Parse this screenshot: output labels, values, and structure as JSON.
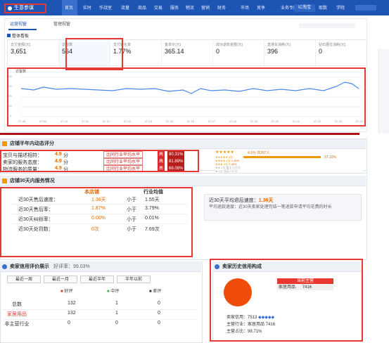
{
  "topbar": {
    "brand": "生意参谋",
    "nav": [
      "首页",
      "实时",
      "作战室",
      "流量",
      "商品",
      "交易",
      "服务",
      "物流",
      "营销",
      "财务",
      "市场",
      "竞争",
      "业务专区",
      "取数",
      "学院"
    ],
    "pill": "IC淘宝"
  },
  "panel1": {
    "tab_active": "运营视窗",
    "tab_other": "管理视窗",
    "section_title": "整体看板",
    "metrics": [
      {
        "title": "支付金额(元)",
        "value": "3,651"
      },
      {
        "title": "访客数",
        "value": "564"
      },
      {
        "title": "支付转化率",
        "value": "1.77%"
      },
      {
        "title": "客单价(元)",
        "value": "365.14"
      },
      {
        "title": "成功退款金额(元)",
        "value": "0"
      },
      {
        "title": "直通车消耗(元)",
        "value": "396"
      },
      {
        "title": "钻石展位消耗(元)",
        "value": "0"
      }
    ],
    "chart_title": "访客数",
    "y_labels": [
      "800",
      "600",
      "400",
      "200",
      "0"
    ],
    "x_labels": [
      "07-08",
      "07-09",
      "07-10",
      "07-11",
      "07-12",
      "07-13",
      "07-14",
      "07-15",
      "07-16",
      "07-17",
      "07-18",
      "07-19",
      "07-20",
      "07-21",
      "07-22",
      "07-23",
      "07-24"
    ]
  },
  "dsr": {
    "title": "店铺半年内动态评分",
    "rows": [
      {
        "label": "宝贝与描述相符：",
        "score": "4.9",
        "unit": "分",
        "compare": "比同行业平均水平",
        "high": "高",
        "pct": "80.31%"
      },
      {
        "label": "卖家的服务态度：",
        "score": "4.9",
        "unit": "分",
        "compare": "比同行业平均水平",
        "high": "高",
        "pct": "81.89%"
      },
      {
        "label": "物流服务的质量：",
        "score": "4.9",
        "unit": "分",
        "compare": "比同行业平均水平",
        "high": "高",
        "pct": "68.08%"
      }
    ],
    "stars_summary": "4.9分  共207人",
    "dist": [
      {
        "label": "5分",
        "pct": "97.10%"
      },
      {
        "label": "4分",
        "pct": "1.45%"
      },
      {
        "label": "3分",
        "pct": "1.45%"
      },
      {
        "label": "2分",
        "pct": "暂无人打分"
      },
      {
        "label": "1分",
        "pct": "暂无人打分"
      }
    ]
  },
  "service30": {
    "title": "店铺30天内服务情况",
    "col_store": "本店铺",
    "col_avg": "行业均值",
    "rows": [
      {
        "label": "近30天售后速度：",
        "store": "1.36天",
        "cmp": "小于",
        "avg": "1.55天"
      },
      {
        "label": "近30天售后率：",
        "store": "1.87%",
        "cmp": "小于",
        "avg": "3.79%"
      },
      {
        "label": "近30天纠纷率：",
        "store": "0.00%",
        "cmp": "小于",
        "avg": "0.01%"
      },
      {
        "label": "近30天处罚数：",
        "store": "0次",
        "cmp": "小于",
        "avg": "7.69次"
      }
    ],
    "side_title": "近30天平均退后速度：",
    "side_value": "1.36天",
    "side_desc": "平均退款速度：近30天卖家处理完结一笔退款申请平均花费的时长"
  },
  "reviews": {
    "title": "卖家信用评价展示",
    "rate_label": "好评率：",
    "rate": "99.03%",
    "periods": [
      "最近一周",
      "最近一月",
      "最近半年",
      "半年以前"
    ],
    "cols": [
      "好评",
      "中评",
      "差评"
    ],
    "rows": [
      {
        "label": "总数",
        "vals": [
          "132",
          "1",
          "0"
        ]
      },
      {
        "label": "家居用品",
        "vals": [
          "132",
          "1",
          "0"
        ]
      },
      {
        "label": "非主营行业",
        "vals": [
          "0",
          "0",
          "0"
        ]
      }
    ]
  },
  "history": {
    "title": "卖家历史信用构成",
    "legend_title": "当前主营",
    "legend_item": "家居用品",
    "legend_val": "7416",
    "credit_label": "卖家信用：",
    "credit_val": "7513",
    "main_label": "主营行业：",
    "main_val": "家居用品 7416",
    "share_label": "主营占比：",
    "share_val": "98.71%"
  },
  "colors": {
    "brand": "#1e55b4",
    "accent_red": "#e53935",
    "orange": "#e66a00"
  }
}
